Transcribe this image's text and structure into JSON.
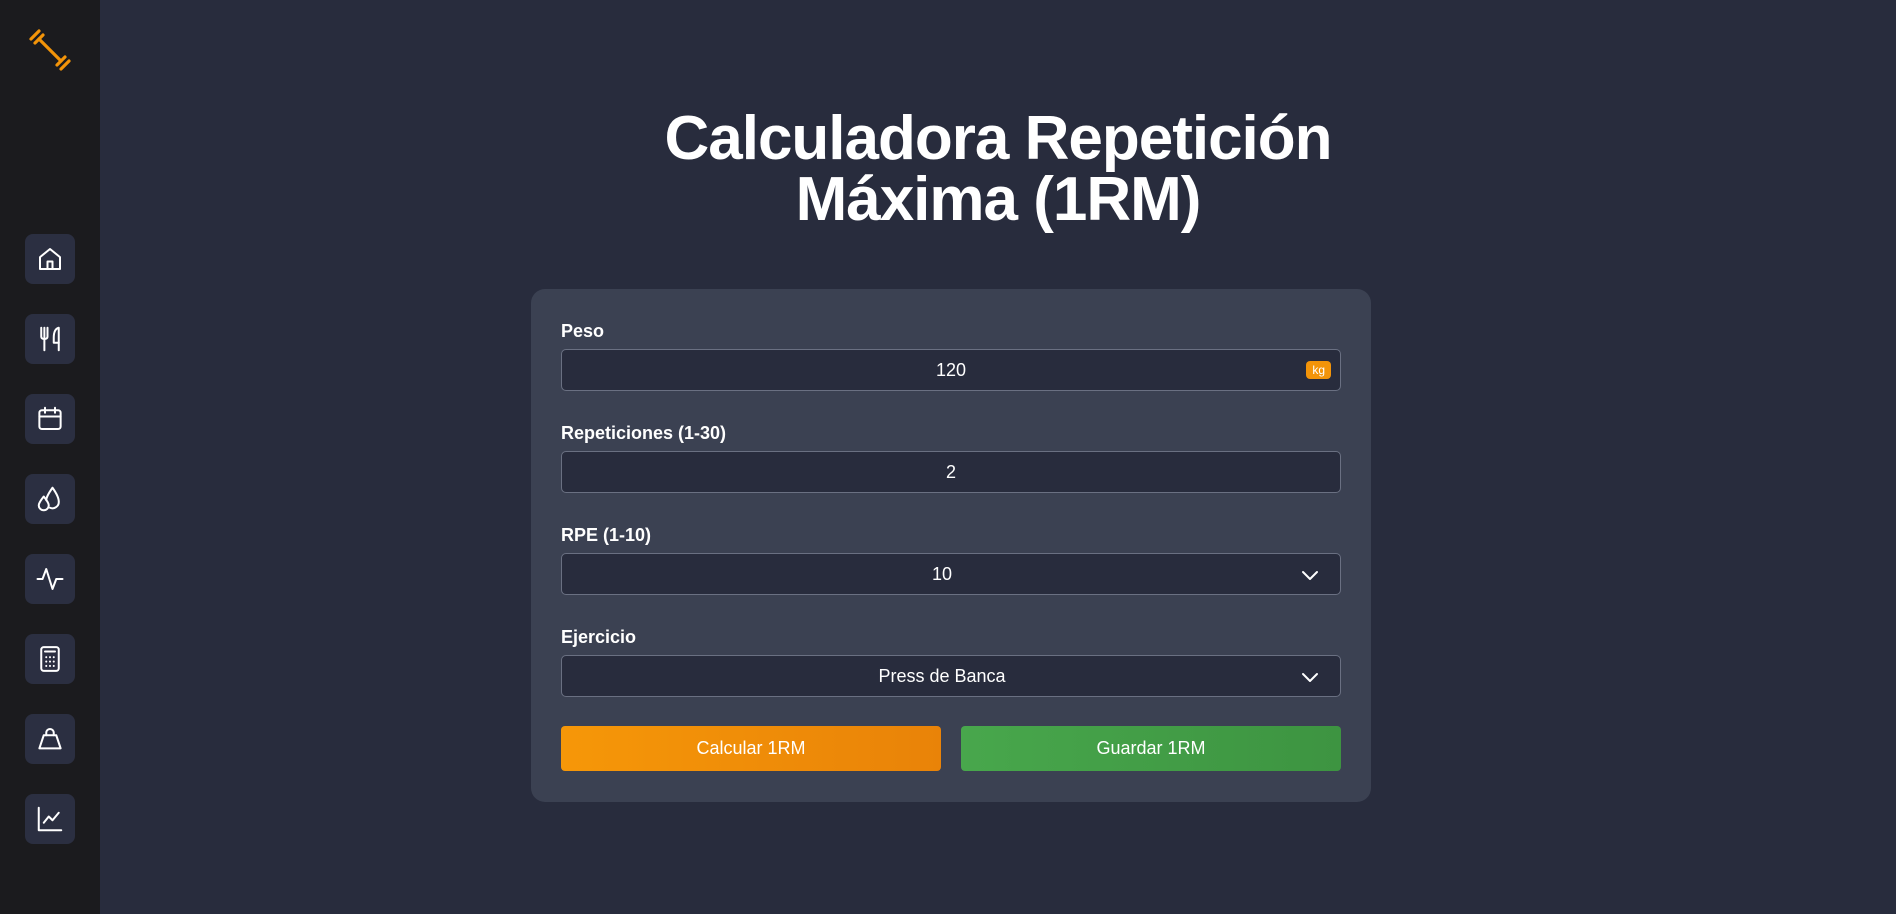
{
  "sidebar": {
    "logo_icon": "dumbbell-icon",
    "items": [
      {
        "id": "home",
        "icon": "home-icon"
      },
      {
        "id": "nutrition",
        "icon": "fork-knife-icon"
      },
      {
        "id": "calendar",
        "icon": "calendar-icon"
      },
      {
        "id": "hydration",
        "icon": "droplets-icon"
      },
      {
        "id": "activity",
        "icon": "activity-icon"
      },
      {
        "id": "calculator",
        "icon": "calculator-icon"
      },
      {
        "id": "weight",
        "icon": "kettlebell-icon"
      },
      {
        "id": "progress",
        "icon": "chart-line-icon"
      }
    ]
  },
  "page": {
    "title_line1": "Calculadora Repetición",
    "title_line2": "Máxima (1RM)"
  },
  "form": {
    "weight": {
      "label": "Peso",
      "value": "120",
      "unit": "kg"
    },
    "reps": {
      "label": "Repeticiones (1-30)",
      "value": "2"
    },
    "rpe": {
      "label": "RPE (1-10)",
      "value": "10"
    },
    "exercise": {
      "label": "Ejercicio",
      "value": "Press de Banca"
    },
    "calculate_label": "Calcular 1RM",
    "save_label": "Guardar 1RM"
  },
  "colors": {
    "accent": "#f39409",
    "save": "#48a74c",
    "background": "#282c3d",
    "card": "#3b4152",
    "sidebar": "#1b1b1e"
  }
}
